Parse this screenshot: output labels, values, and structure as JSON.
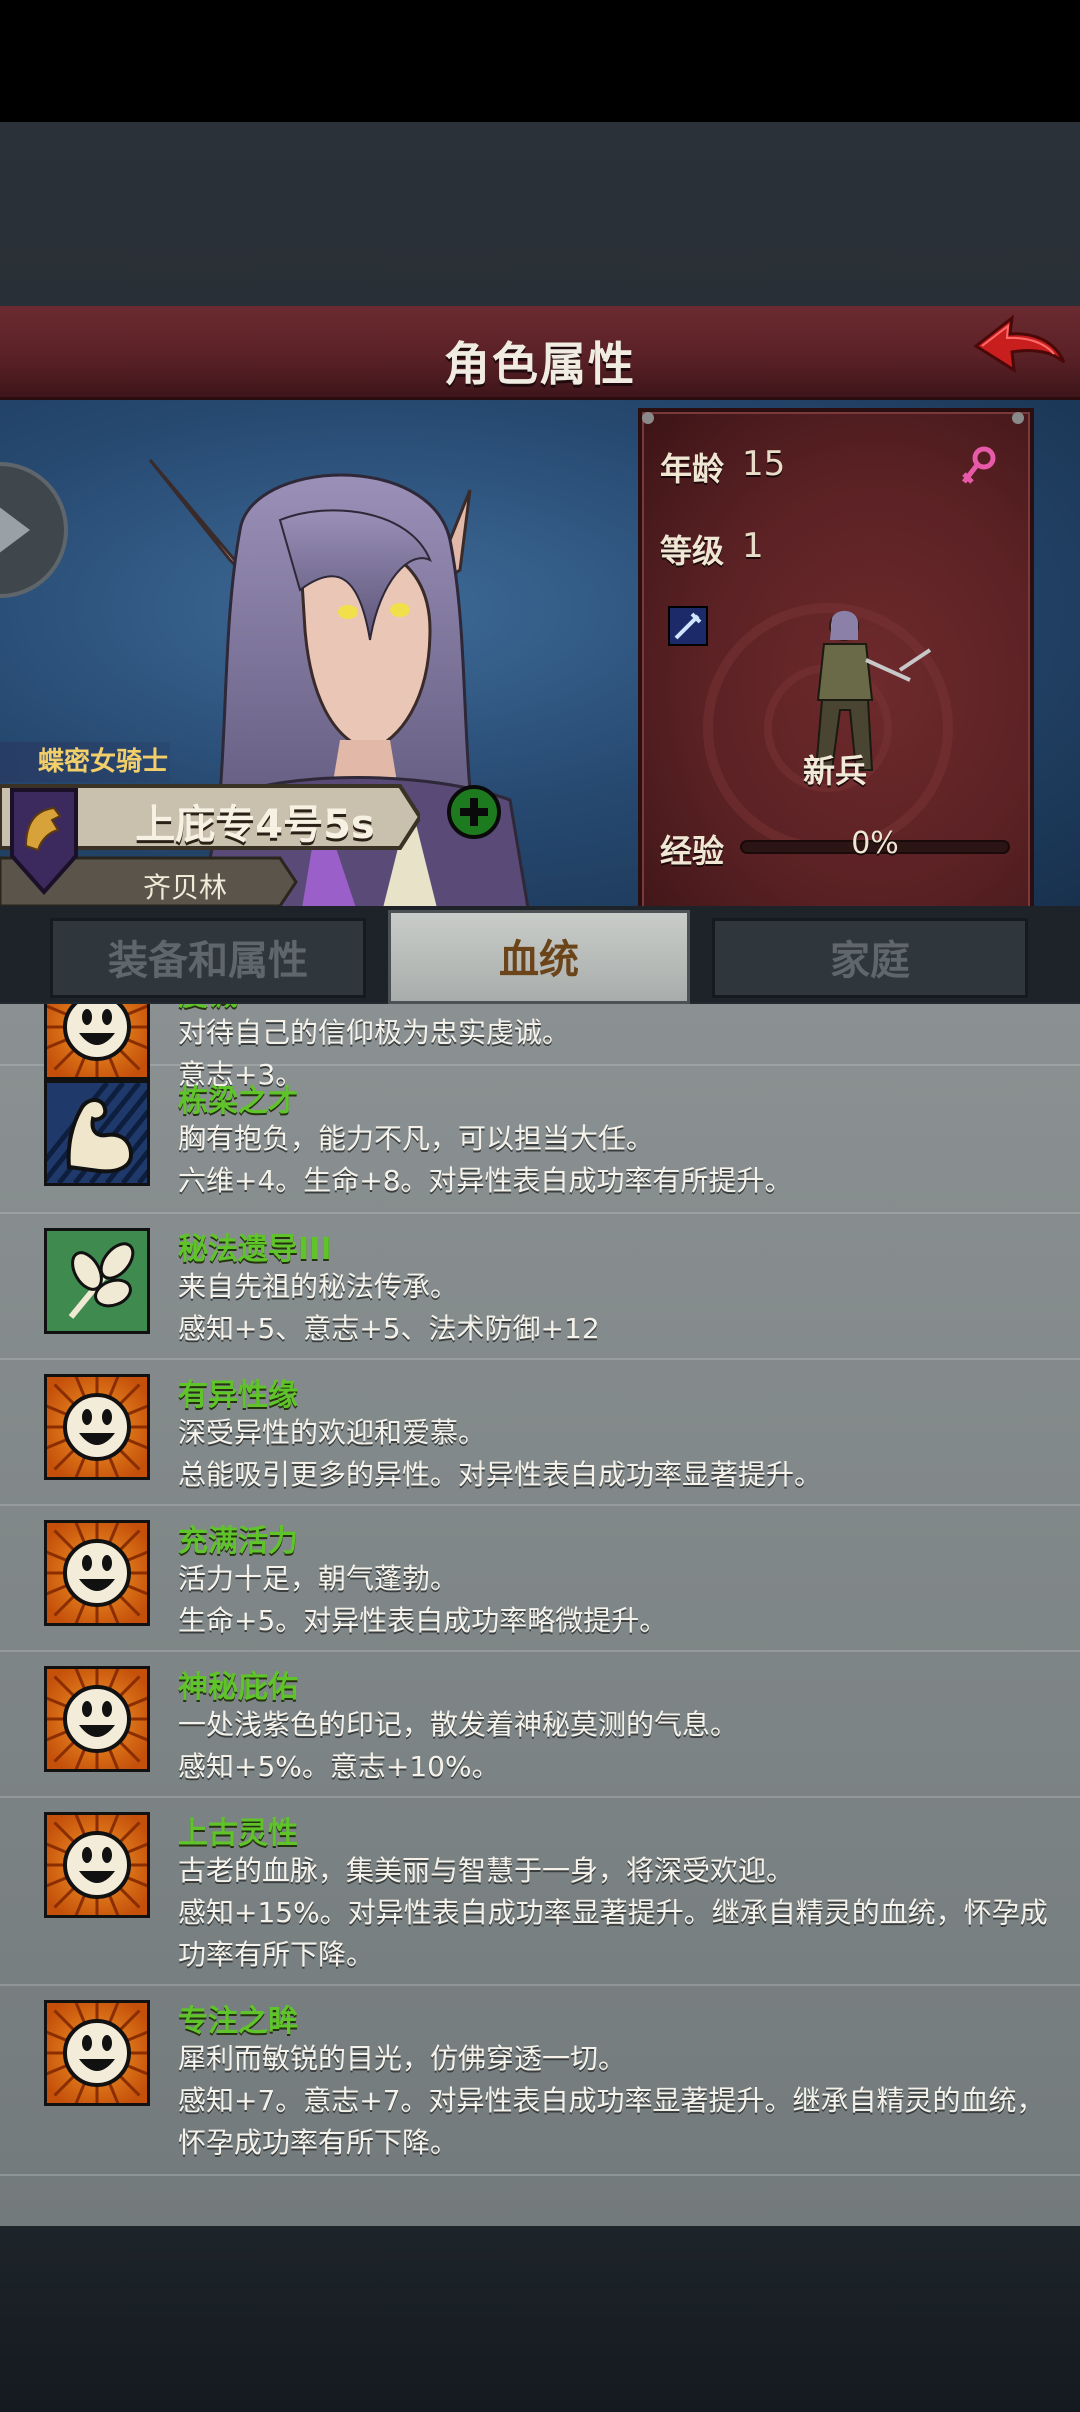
{
  "header": {
    "title": "角色属性"
  },
  "stats": {
    "age_label": "年龄",
    "age_value": "15",
    "level_label": "等级",
    "level_value": "1",
    "exp_label": "经验",
    "exp_value": "0%",
    "exp_progress": 0,
    "class_name": "新兵",
    "gender_icon": "female-symbol-icon",
    "weapon_icon": "sword-skill-icon"
  },
  "character": {
    "title": "蝶密女骑士",
    "name": "上庇专4号5s",
    "family": "齐贝林"
  },
  "tabs": [
    {
      "label": "装备和属性",
      "active": false
    },
    {
      "label": "血统",
      "active": true
    },
    {
      "label": "家庭",
      "active": false
    }
  ],
  "traits": [
    {
      "name": "虔诚",
      "desc": "对待自己的信仰极为忠实虔诚。",
      "effect": "意志+3。",
      "icon": "smiley-face-icon"
    },
    {
      "name": "栋梁之才",
      "desc": "胸有抱负，能力不凡，可以担当大任。",
      "effect": "六维+4。生命+8。对异性表白成功率有所提升。",
      "icon": "flexed-arm-icon"
    },
    {
      "name": "秘法遗导III",
      "desc": "来自先祖的秘法传承。",
      "effect": "感知+5、意志+5、法术防御+12",
      "icon": "leaf-branch-icon"
    },
    {
      "name": "有异性缘",
      "desc": "深受异性的欢迎和爱慕。",
      "effect": "总能吸引更多的异性。对异性表白成功率显著提升。",
      "icon": "smiley-face-icon"
    },
    {
      "name": "充满活力",
      "desc": "活力十足，朝气蓬勃。",
      "effect": "生命+5。对异性表白成功率略微提升。",
      "icon": "smiley-face-icon"
    },
    {
      "name": "神秘庇佑",
      "desc": "一处浅紫色的印记，散发着神秘莫测的气息。",
      "effect": "感知+5%。意志+10%。",
      "icon": "smiley-face-icon"
    },
    {
      "name": "上古灵性",
      "desc": "古老的血脉，集美丽与智慧于一身，将深受欢迎。",
      "effect": "感知+15%。对异性表白成功率显著提升。继承自精灵的血统，怀孕成功率有所下降。",
      "icon": "smiley-face-icon"
    },
    {
      "name": "专注之眸",
      "desc": "犀利而敏锐的目光，仿佛穿透一切。",
      "effect": "感知+7。意志+7。对异性表白成功率显著提升。继承自精灵的血统，怀孕成功率有所下降。",
      "icon": "smiley-face-icon"
    }
  ]
}
